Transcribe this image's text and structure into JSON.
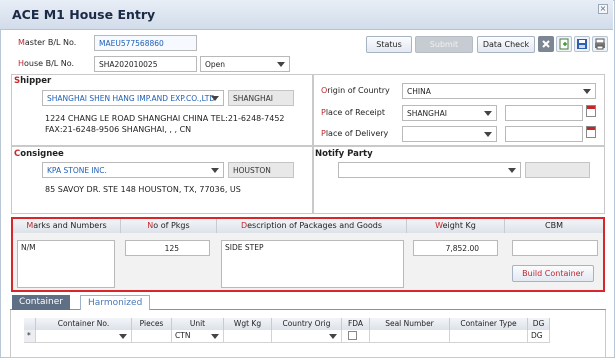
{
  "window": {
    "title": "ACE M1 House Entry",
    "close_glyph": "×"
  },
  "header": {
    "master_bl_label": "Master B/L No.",
    "master_bl_value": "MAEU577568860",
    "house_bl_label": "House B/L No.",
    "house_bl_value": "SHA202010025",
    "status_select": "Open"
  },
  "toolbar": {
    "status": "Status",
    "submit": "Submit",
    "data_check": "Data Check"
  },
  "shipper": {
    "title": "Shipper",
    "name": "SHANGHAI SHEN HANG IMP.AND EXP.CO.,LTD",
    "city": "SHANGHAI",
    "address_line1": "1224 CHANG LE ROAD SHANGHAI CHINA TEL:21-6248-7452",
    "address_line2": "FAX:21-6248-9506 SHANGHAI, , , CN"
  },
  "routing": {
    "origin_label": "Origin of Country",
    "origin_value": "CHINA",
    "receipt_label": "Place of Receipt",
    "receipt_value": "SHANGHAI",
    "delivery_label": "Place of Delivery",
    "delivery_value": ""
  },
  "consignee": {
    "title": "Consignee",
    "name": "KPA STONE INC.",
    "city": "HOUSTON",
    "address": "85 SAVOY DR. STE 148 HOUSTON, TX, 77036, US"
  },
  "notify": {
    "title": "Notify Party",
    "value": ""
  },
  "goods": {
    "headers": [
      "Marks and Numbers",
      "No of Pkgs",
      "Description of Packages and Goods",
      "Weight Kg",
      "CBM"
    ],
    "marks": "N/M",
    "pkgs": "125",
    "description": "SIDE STEP",
    "weight": "7,852.00",
    "cbm": "",
    "build_container": "Build Container"
  },
  "tabs": [
    {
      "label": "Container"
    },
    {
      "label": "Harmonized"
    }
  ],
  "container_table": {
    "headers": [
      "Container No.",
      "Pieces",
      "Unit",
      "Wgt Kg",
      "Country Orig",
      "FDA",
      "Seal Number",
      "Container Type",
      "DG"
    ],
    "row_marker": "*",
    "unit": "CTN",
    "dg": "DG"
  },
  "colors": {
    "accent_red": "#c0282c",
    "highlight_box": "#d9262b",
    "active_tab": "#5f6f86"
  }
}
